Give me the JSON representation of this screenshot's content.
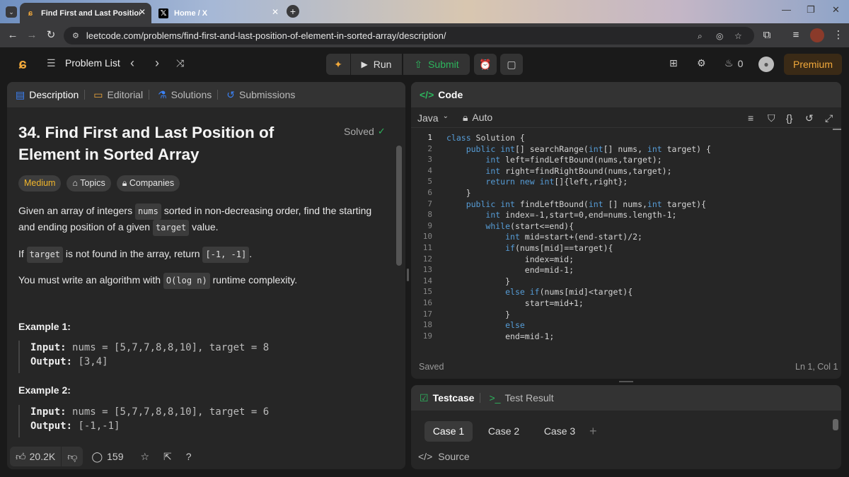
{
  "browser": {
    "tabs": [
      {
        "title": "Find First and Last Position of E"
      },
      {
        "title": "Home / X"
      }
    ],
    "url": "leetcode.com/problems/find-first-and-last-position-of-element-in-sorted-array/description/"
  },
  "header": {
    "problem_list": "Problem List",
    "run": "Run",
    "submit": "Submit",
    "streak": "0",
    "premium": "Premium"
  },
  "left_panel": {
    "tabs": [
      "Description",
      "Editorial",
      "Solutions",
      "Submissions"
    ],
    "title": "34. Find First and Last Position of Element in Sorted Array",
    "solved": "Solved",
    "tags": [
      "Medium",
      "Topics",
      "Companies"
    ],
    "para1": [
      "Given an array of integers ",
      "nums",
      " sorted in non-decreasing order, find the starting and ending position of a given ",
      "target",
      " value."
    ],
    "para2": [
      "If ",
      "target",
      " is not found in the array, return ",
      "[-1, -1]",
      "."
    ],
    "para3": [
      "You must write an algorithm with ",
      "O(log n)",
      " runtime complexity."
    ],
    "example1": {
      "title": "Example 1:",
      "input_label": "Input:",
      "input": "nums = [5,7,7,8,8,10], target = 8",
      "output_label": "Output:",
      "output": "[3,4]"
    },
    "example2": {
      "title": "Example 2:",
      "input_label": "Input:",
      "input": "nums = [5,7,7,8,8,10], target = 6",
      "output_label": "Output:",
      "output": "[-1,-1]"
    },
    "footer": {
      "likes": "20.2K",
      "comments": "159"
    }
  },
  "code_panel": {
    "title": "Code",
    "language": "Java",
    "mode": "Auto",
    "status": "Saved",
    "cursor": "Ln 1, Col 1",
    "lines": [
      "class Solution {",
      "    public int[] searchRange(int[] nums, int target) {",
      "        int left=findLeftBound(nums,target);",
      "        int right=findRightBound(nums,target);",
      "        return new int[]{left,right};",
      "    }",
      "    public int findLeftBound(int [] nums,int target){",
      "        int index=-1,start=0,end=nums.length-1;",
      "        while(start<=end){",
      "            int mid=start+(end-start)/2;",
      "            if(nums[mid]==target){",
      "                index=mid;",
      "                end=mid-1;",
      "            }",
      "            else if(nums[mid]<target){",
      "                start=mid+1;",
      "            }",
      "            else",
      "            end=mid-1;"
    ],
    "line_numbers": [
      "1",
      "2",
      "3",
      "4",
      "5",
      "6",
      "7",
      "8",
      "9",
      "10",
      "11",
      "12",
      "13",
      "14",
      "15",
      "16",
      "17",
      "18",
      "19"
    ]
  },
  "test_panel": {
    "tabs": [
      "Testcase",
      "Test Result"
    ],
    "cases": [
      "Case 1",
      "Case 2",
      "Case 3"
    ],
    "source": "Source"
  }
}
